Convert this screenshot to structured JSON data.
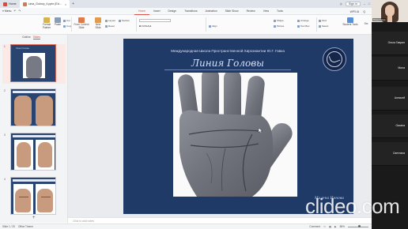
{
  "window": {
    "home_tab": "Home",
    "doc_tab": "Linia_Golovy_4.pptx (Ed...",
    "sign_in": "Sign in"
  },
  "menu": {
    "left_items": [
      "≡ Menu",
      "↶",
      "↷"
    ],
    "tabs": [
      "Home",
      "Insert",
      "Design",
      "Transitions",
      "Animation",
      "Slide Show",
      "Review",
      "View",
      "Tools"
    ],
    "active_tab": "Home",
    "right_items": [
      "WPS AI",
      "Q"
    ]
  },
  "ribbon": {
    "format_painter": "Format Painter",
    "paste": "Paste",
    "cut": "Cut",
    "copy": "Copy",
    "from_current": "From Current Slide",
    "new_slide": "New Slide",
    "layout": "Layout",
    "reset": "Reset",
    "section": "Section",
    "align_options": "Align",
    "shape": "Shape",
    "picture": "Picture",
    "arrange": "Arrange",
    "textbox": "Text Box",
    "select": "Select",
    "find": "Find",
    "replace": "Replace",
    "student_tools": "Student Tools",
    "sm": "Sm"
  },
  "leftpane": {
    "tab_outline": "Outline",
    "tab_slides": "Slides",
    "slide_numbers": [
      "1",
      "2",
      "3",
      "4"
    ],
    "thumb1_caption": "Линия Головы",
    "add_icon": "+"
  },
  "slide": {
    "school": "Международная Школа Пространственной Хирознантии Ю.Г. Гавка",
    "title": "Линия Головы",
    "author": "Милена Иннова"
  },
  "notes_placeholder": "Click to add notes",
  "status": {
    "slide": "Slide 1 / 25",
    "theme": "Office Theme",
    "comment": "Comment",
    "zoom": "88%"
  },
  "participants": {
    "self_name": "Юлия Гавка",
    "names": [
      "Ольга Гаврил",
      "Мила",
      "Алексей",
      "Оксана",
      "Светлана"
    ]
  },
  "watermark": "clideo.com"
}
